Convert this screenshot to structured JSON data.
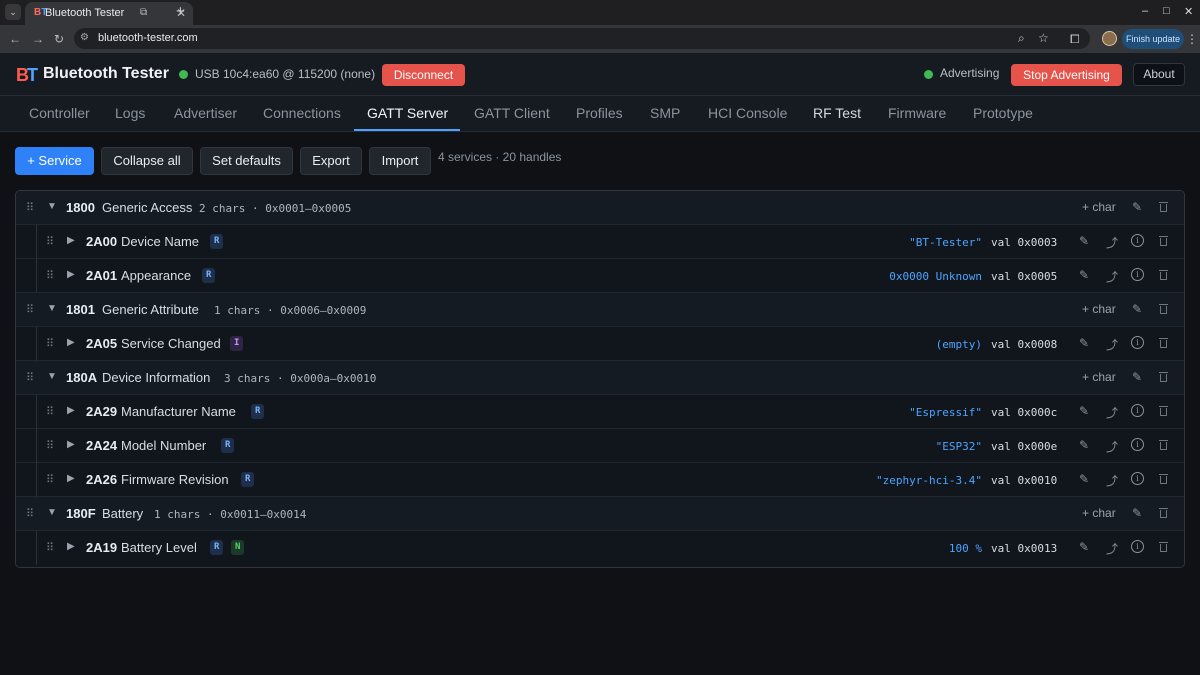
{
  "browser": {
    "tab_title": "Bluetooth Tester",
    "url": "bluetooth-tester.com",
    "finish_update": "Finish update"
  },
  "header": {
    "app_title": "Bluetooth Tester",
    "connection_status": "USB 10c4:ea60 @ 115200 (none)",
    "disconnect_label": "Disconnect",
    "advertising_status": "Advertising",
    "stop_advertising_label": "Stop Advertising",
    "about_label": "About"
  },
  "tabs": [
    {
      "label": "Controller"
    },
    {
      "label": "Logs"
    },
    {
      "label": "Advertiser"
    },
    {
      "label": "Connections"
    },
    {
      "label": "GATT Server"
    },
    {
      "label": "GATT Client"
    },
    {
      "label": "Profiles"
    },
    {
      "label": "SMP"
    },
    {
      "label": "HCI Console"
    },
    {
      "label": "RF Test"
    },
    {
      "label": "Firmware"
    },
    {
      "label": "Prototype"
    }
  ],
  "active_tab": "GATT Server",
  "toolbar": {
    "add_service_label": "+ Service",
    "collapse_all_label": "Collapse all",
    "set_defaults_label": "Set defaults",
    "export_label": "Export",
    "import_label": "Import",
    "summary": "4 services · 20 handles"
  },
  "add_char_label": "+ char",
  "services": [
    {
      "uuid": "1800",
      "name": "Generic Access",
      "meta": "2 chars · 0x0001–0x0005",
      "characteristics": [
        {
          "uuid": "2A00",
          "name": "Device Name",
          "props": [
            "R"
          ],
          "value": "\"BT-Tester\"",
          "handle": "val 0x0003"
        },
        {
          "uuid": "2A01",
          "name": "Appearance",
          "props": [
            "R"
          ],
          "value": "0x0000 Unknown",
          "handle": "val 0x0005"
        }
      ]
    },
    {
      "uuid": "1801",
      "name": "Generic Attribute",
      "meta": "1 chars · 0x0006–0x0009",
      "characteristics": [
        {
          "uuid": "2A05",
          "name": "Service Changed",
          "props": [
            "I"
          ],
          "value": "(empty)",
          "handle": "val 0x0008"
        }
      ]
    },
    {
      "uuid": "180A",
      "name": "Device Information",
      "meta": "3 chars · 0x000a–0x0010",
      "characteristics": [
        {
          "uuid": "2A29",
          "name": "Manufacturer Name",
          "props": [
            "R"
          ],
          "value": "\"Espressif\"",
          "handle": "val 0x000c"
        },
        {
          "uuid": "2A24",
          "name": "Model Number",
          "props": [
            "R"
          ],
          "value": "\"ESP32\"",
          "handle": "val 0x000e"
        },
        {
          "uuid": "2A26",
          "name": "Firmware Revision",
          "props": [
            "R"
          ],
          "value": "\"zephyr-hci-3.4\"",
          "handle": "val 0x0010"
        }
      ]
    },
    {
      "uuid": "180F",
      "name": "Battery",
      "meta": "1 chars · 0x0011–0x0014",
      "characteristics": [
        {
          "uuid": "2A19",
          "name": "Battery Level",
          "props": [
            "R",
            "N"
          ],
          "value": "100 %",
          "handle": "val 0x0013"
        }
      ]
    }
  ],
  "colors": {
    "accent": "#2f81f7",
    "danger": "#e5534b",
    "status_ok": "#3fb950",
    "value_text": "#4ea3ff"
  }
}
